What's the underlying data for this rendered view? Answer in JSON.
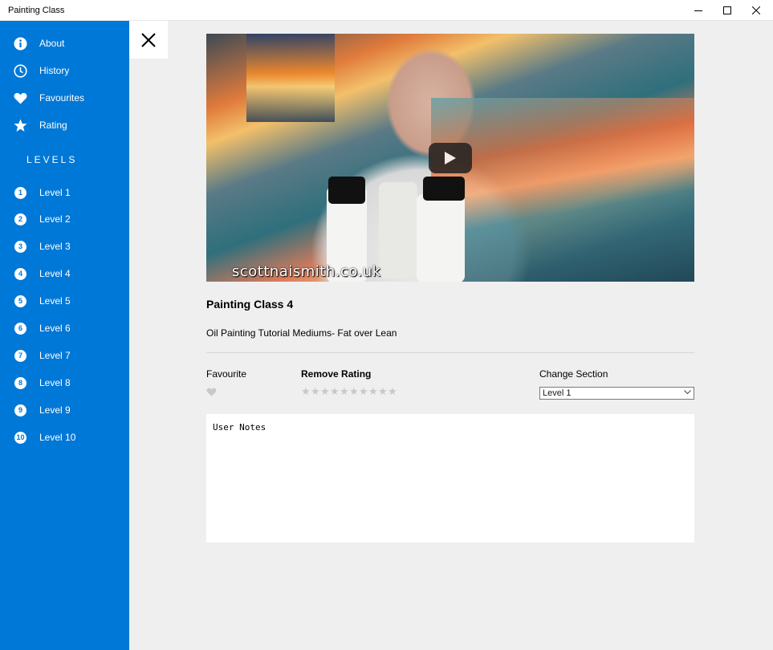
{
  "window": {
    "title": "Painting Class",
    "minimize_icon": "minimize-icon",
    "maximize_icon": "maximize-icon",
    "close_icon": "close-icon"
  },
  "sidebar": {
    "items": [
      {
        "label": "About",
        "icon": "info-icon"
      },
      {
        "label": "History",
        "icon": "clock-icon"
      },
      {
        "label": "Favourites",
        "icon": "heart-icon"
      },
      {
        "label": "Rating",
        "icon": "star-icon"
      }
    ],
    "levels_header": "LEVELS",
    "levels": [
      {
        "number": "1",
        "label": "Level 1"
      },
      {
        "number": "2",
        "label": "Level 2"
      },
      {
        "number": "3",
        "label": "Level 3"
      },
      {
        "number": "4",
        "label": "Level 4"
      },
      {
        "number": "5",
        "label": "Level 5"
      },
      {
        "number": "6",
        "label": "Level 6"
      },
      {
        "number": "7",
        "label": "Level 7"
      },
      {
        "number": "8",
        "label": "Level 8"
      },
      {
        "number": "9",
        "label": "Level 9"
      },
      {
        "number": "10",
        "label": "Level 10"
      }
    ]
  },
  "main": {
    "close_pane_icon": "close-icon",
    "video": {
      "watermark": "scottnaismith.co.uk",
      "play_icon": "play-icon"
    },
    "title": "Painting Class 4",
    "subtitle": "Oil Painting Tutorial Mediums- Fat over Lean",
    "favourite_label": "Favourite",
    "favourite_icon": "heart-icon",
    "rating_label": "Remove Rating",
    "rating": {
      "value": 0,
      "max": 10
    },
    "section_label": "Change Section",
    "section_selected": "Level 1",
    "notes_text": "User Notes"
  },
  "colors": {
    "accent": "#0078d7",
    "main_bg": "#efefef",
    "star_empty": "#c8c8c8"
  }
}
